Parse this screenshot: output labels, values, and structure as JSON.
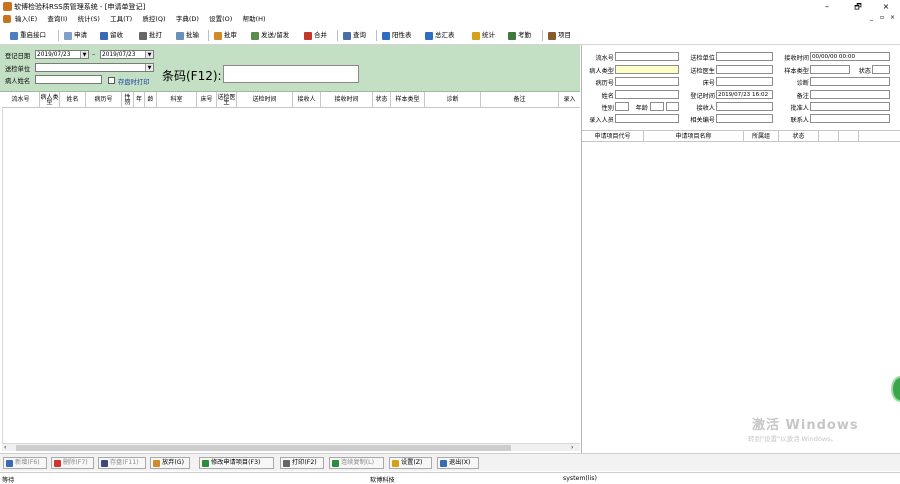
{
  "window": {
    "title": "软博检验科RSS质管理系统 - [申请单登记]",
    "controls": {
      "minimize": "–",
      "restore": "🗗",
      "close": "×"
    },
    "inner_controls": {
      "minimize": "_",
      "restore": "▫",
      "close": "×"
    }
  },
  "menu": [
    {
      "label": "输入(E)"
    },
    {
      "label": "查询(I)"
    },
    {
      "label": "统计(S)"
    },
    {
      "label": "工具(T)"
    },
    {
      "label": "质控(Q)"
    },
    {
      "label": "字典(D)"
    },
    {
      "label": "设置(O)"
    },
    {
      "label": "帮助(H)"
    }
  ],
  "toolbar": [
    {
      "label": "重启接口",
      "icon": "restart-icon",
      "color": "#4a7fc1"
    },
    {
      "label": "申请",
      "icon": "apply-icon",
      "color": "#7f9fc8"
    },
    {
      "label": "留收",
      "icon": "receive-icon",
      "color": "#3a6ab5"
    },
    {
      "label": "批打",
      "icon": "print-icon",
      "color": "#666666"
    },
    {
      "label": "批输",
      "icon": "batch-input-icon",
      "color": "#6a8fb8"
    },
    {
      "label": "批审",
      "icon": "batch-review-icon",
      "color": "#d08a2a"
    },
    {
      "label": "发送/留发",
      "icon": "send-icon",
      "color": "#5c8c4a"
    },
    {
      "label": "合并",
      "icon": "merge-icon",
      "color": "#c0392b"
    },
    {
      "label": "查询",
      "icon": "query-icon",
      "color": "#4a6fa5"
    },
    {
      "label": "阳性表",
      "icon": "positive-table-icon",
      "color": "#2f6cc4"
    },
    {
      "label": "总汇表",
      "icon": "summary-table-icon",
      "color": "#2f6cc4"
    },
    {
      "label": "统计",
      "icon": "statistics-icon",
      "color": "#d4a017"
    },
    {
      "label": "考勤",
      "icon": "attendance-icon",
      "color": "#3d7a3d"
    },
    {
      "label": "项目",
      "icon": "project-icon",
      "color": "#8a5a2a"
    }
  ],
  "filter": {
    "date_label": "登记日期",
    "date_from": "2019/07/23",
    "date_sep": "–",
    "date_to": "2019/07/23",
    "unit_label": "送检单位",
    "unit_value": "",
    "patient_label": "病人姓名",
    "patient_value": "",
    "print_on_save_label": "存盘时打印",
    "barcode_label": "条码(F12):",
    "barcode_value": ""
  },
  "grid_columns": [
    "流水号",
    "病人类型",
    "姓名",
    "病历号",
    "性别",
    "年",
    "龄",
    "科室",
    "床号",
    "送检医生",
    "送检时间",
    "接收人",
    "接收时间",
    "状态",
    "样本类型",
    "诊断",
    "备注",
    "录入"
  ],
  "detail": {
    "serial_label": "流水号",
    "serial_value": "",
    "patient_type_label": "病人类型",
    "patient_type_value": "",
    "record_label": "病历号",
    "record_value": "",
    "name_label": "姓名",
    "name_value": "",
    "gender_label": "性别",
    "gender_value": "",
    "age_label": "年龄",
    "age_value": "",
    "age_unit": "",
    "entry_person_label": "录入人员",
    "entry_person_value": "",
    "unit_label": "送检单位",
    "unit_value": "",
    "doctor_label": "送检医生",
    "doctor_value": "",
    "bed_label": "床号",
    "bed_value": "",
    "reg_time_label": "登记时间",
    "reg_time_value": "2019/07/23 16:02",
    "receiver_label": "接收人",
    "receiver_value": "",
    "related_no_label": "相关编号",
    "related_no_value": "",
    "receive_time_label": "接收时间",
    "receive_time_value": "00/00/00 00:00",
    "sample_type_label": "样本类型",
    "sample_type_value": "",
    "status_label": "状态",
    "status_value": "",
    "diagnosis_label": "诊断",
    "diagnosis_value": "",
    "remark_label": "备注",
    "remark_value": "",
    "approver_label": "批准人",
    "approver_value": "",
    "contact_label": "联系人",
    "contact_value": ""
  },
  "request_grid_columns": [
    "申请项目代号",
    "申请项目名称",
    "所属组",
    "状态"
  ],
  "bottom_buttons": [
    {
      "label": "新增(F6)",
      "icon": "add-icon",
      "color": "#3a6ab5",
      "disabled": true
    },
    {
      "label": "删除(F7)",
      "icon": "delete-icon",
      "color": "#d0342c",
      "disabled": true
    },
    {
      "label": "存盘(F11)",
      "icon": "save-icon",
      "color": "#3a4a7a",
      "disabled": true
    },
    {
      "label": "放弃(G)",
      "icon": "discard-icon",
      "color": "#d08a2a",
      "disabled": false
    },
    {
      "label": "修改申请项目(F3)",
      "icon": "edit-request-icon",
      "color": "#2e8b3e",
      "disabled": false
    },
    {
      "label": "打印(F2)",
      "icon": "printer-icon",
      "color": "#666666",
      "disabled": false
    },
    {
      "label": "连续复制(L)",
      "icon": "copy-icon",
      "color": "#2e8b3e",
      "disabled": true
    },
    {
      "label": "设置(Z)",
      "icon": "settings-icon",
      "color": "#d4a017",
      "disabled": false
    },
    {
      "label": "退出(X)",
      "icon": "exit-icon",
      "color": "#3a6ab5",
      "disabled": false
    }
  ],
  "status": {
    "left": "等待",
    "center": "软博科技",
    "right": "system(lis)"
  },
  "watermark": {
    "line1": "激活 Windows",
    "line2": "转到\"设置\"以激活 Windows。"
  }
}
